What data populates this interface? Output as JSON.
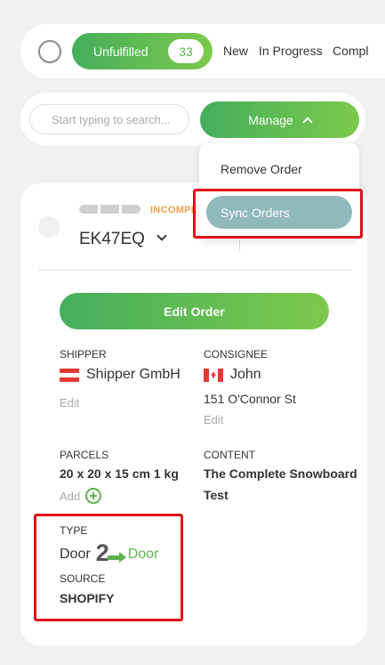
{
  "filter_tabs": {
    "active_label": "Unfulfilled",
    "active_count": "33",
    "tabs": [
      "New",
      "In Progress",
      "Compl"
    ]
  },
  "search": {
    "placeholder": "Start typing to search..."
  },
  "manage": {
    "label": "Manage",
    "menu": [
      "Remove Order",
      "Sync Orders"
    ],
    "selected_index": 1
  },
  "order": {
    "status": "INCOMPL",
    "id": "EK47EQ",
    "right_partial": "...",
    "edit_label": "Edit Order",
    "shipper": {
      "label": "SHIPPER",
      "name": "Shipper GmbH",
      "edit": "Edit",
      "flag": "austria"
    },
    "consignee": {
      "label": "CONSIGNEE",
      "name": "John",
      "address": "151 O'Connor St",
      "edit": "Edit",
      "flag": "canada"
    },
    "parcels": {
      "label": "PARCELS",
      "value": "20 x 20 x 15 cm 1 kg",
      "add": "Add"
    },
    "content": {
      "label": "CONTENT",
      "value": "The Complete Snowboard Test"
    },
    "type": {
      "label": "TYPE",
      "from": "Door",
      "num": "2",
      "to": "Door"
    },
    "source": {
      "label": "SOURCE",
      "value": "SHOPIFY"
    }
  },
  "colors": {
    "accent_green": "#5db24e",
    "status_orange": "#f0a14a",
    "selected_item": "#8fb9bd",
    "highlight_red": "#e0101a"
  }
}
